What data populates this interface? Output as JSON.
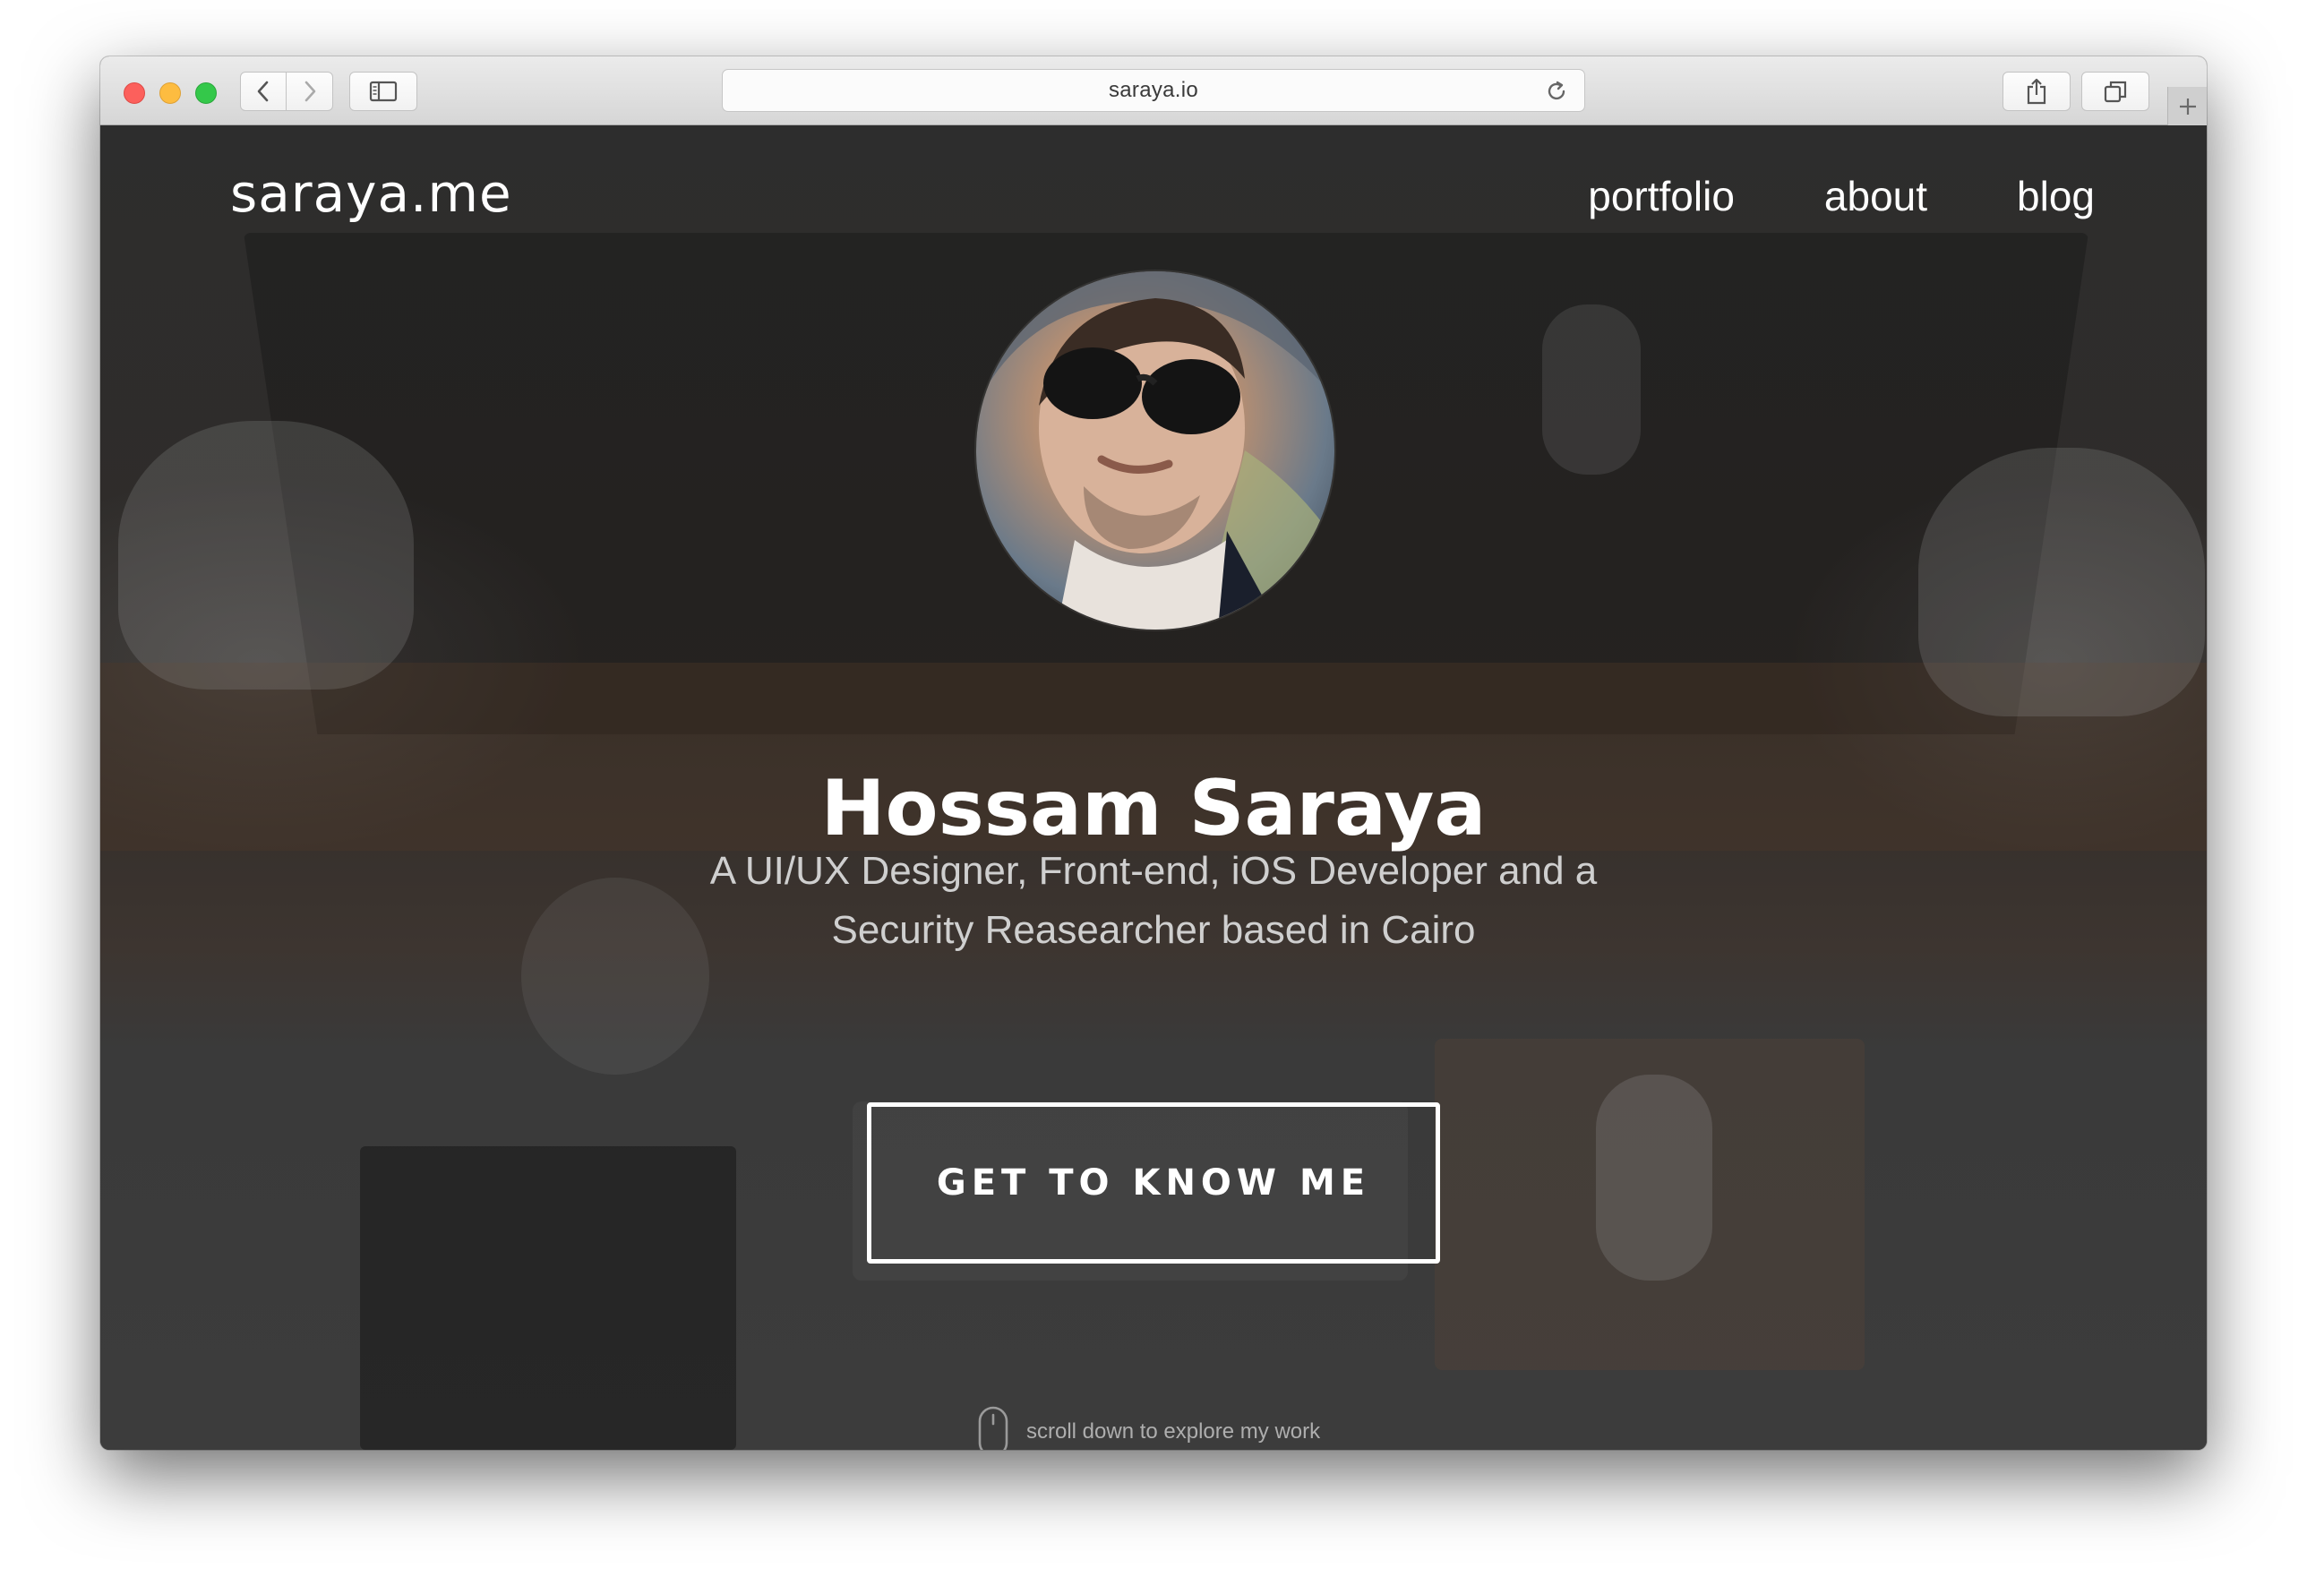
{
  "browser": {
    "address": "saraya.io"
  },
  "site": {
    "logo": "saraya.me",
    "nav": [
      {
        "label": "portfolio"
      },
      {
        "label": "about"
      },
      {
        "label": "blog"
      }
    ]
  },
  "hero": {
    "name": "Hossam Saraya",
    "tagline_line1": "A UI/UX Designer, Front-end, iOS Developer and a",
    "tagline_line2": "Security Reasearcher based in Cairo",
    "cta_label": "GET TO KNOW ME",
    "scroll_hint": "scroll down to explore my work"
  },
  "icons": {
    "back": "chevron-left-icon",
    "forward": "chevron-right-icon",
    "sidebar": "sidebar-icon",
    "reload": "reload-icon",
    "share": "share-icon",
    "tabs": "tabs-icon",
    "new_tab": "plus-icon",
    "scroll": "mouse-icon"
  },
  "colors": {
    "traffic_close": "#fc605c",
    "traffic_minimize": "#fdbc40",
    "traffic_maximize": "#34c84a",
    "hero_text": "#ffffff",
    "tagline_text": "#cfcfcf"
  }
}
